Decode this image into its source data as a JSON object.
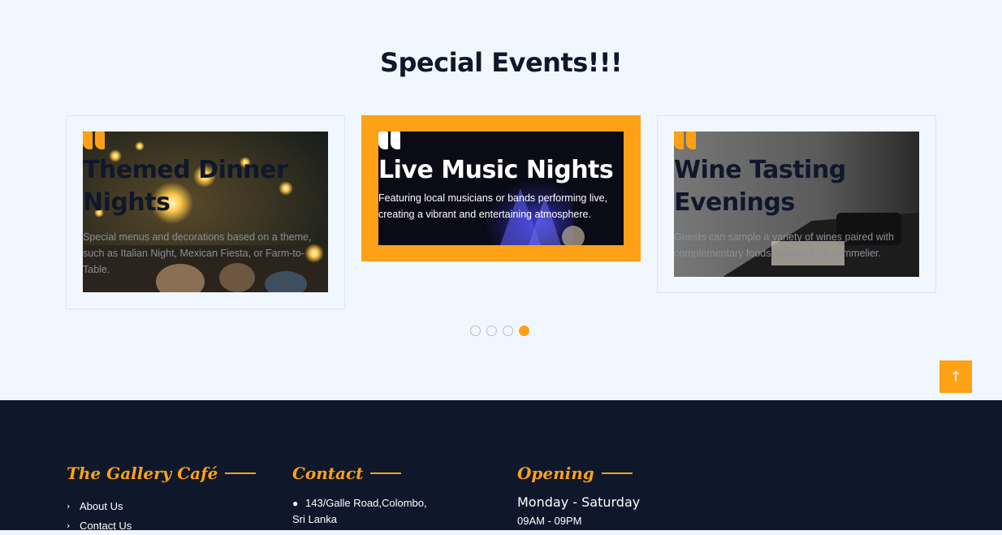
{
  "section": {
    "title": "Special Events!!!"
  },
  "cards": [
    {
      "title": "Themed Dinner Nights",
      "desc": "Special menus and decorations based on a theme, such as Italian Night, Mexican Fiesta, or Farm-to-Table."
    },
    {
      "title": "Live Music Nights",
      "desc": "Featuring local musicians or bands performing live, creating a vibrant and entertaining atmosphere."
    },
    {
      "title": "Wine Tasting Evenings",
      "desc": "Guests can sample a variety of wines paired with complementary foods, guided by a sommelier."
    }
  ],
  "carousel": {
    "active_index": 3,
    "dot_count": 4
  },
  "back_to_top": {
    "icon": "arrow-up-icon",
    "glyph": "↑"
  },
  "footer": {
    "about": {
      "heading": "The Gallery Café",
      "links": [
        "About Us",
        "Contact Us"
      ]
    },
    "contact": {
      "heading": "Contact",
      "address_line1": "143/Galle Road,Colombo,",
      "address_line2": "Sri Lanka"
    },
    "opening": {
      "heading": "Opening",
      "days": "Monday - Saturday",
      "hours": "09AM - 09PM"
    }
  },
  "colors": {
    "accent": "#fea116",
    "dark": "#0f172b",
    "bg": "#f1f7fe"
  }
}
